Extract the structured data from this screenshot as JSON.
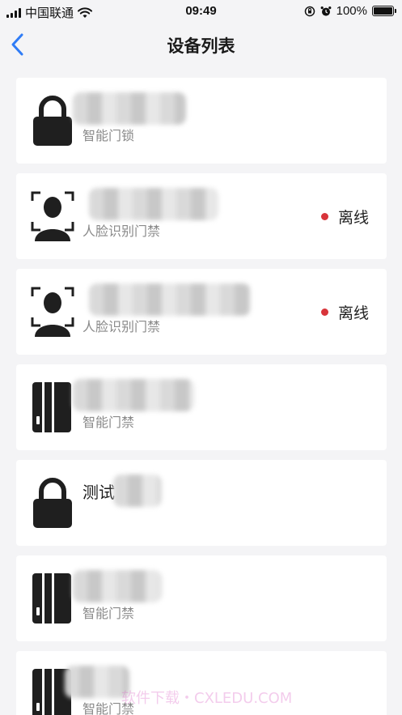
{
  "status_bar": {
    "carrier": "中国联通",
    "time": "09:49",
    "battery": "100%",
    "battery_level": 1.0
  },
  "nav": {
    "title": "设备列表",
    "back_icon": "chevron-left-icon"
  },
  "devices": [
    {
      "name": "",
      "type": "智能门锁",
      "icon": "lock-icon",
      "status": ""
    },
    {
      "name": "",
      "type": "人脸识别门禁",
      "icon": "face-recognition-icon",
      "status": "离线"
    },
    {
      "name": "",
      "type": "人脸识别门禁",
      "icon": "face-recognition-icon",
      "status": "离线"
    },
    {
      "name": "",
      "type": "智能门禁",
      "icon": "card-reader-icon",
      "status": ""
    },
    {
      "name": "测试",
      "type": "",
      "icon": "lock-icon",
      "status": ""
    },
    {
      "name": "",
      "type": "智能门禁",
      "icon": "card-reader-icon",
      "status": ""
    },
    {
      "name": "",
      "type": "智能门禁",
      "icon": "card-reader-icon",
      "status": ""
    }
  ],
  "colors": {
    "accent": "#2f7cf6",
    "offline_dot": "#d8343a",
    "background": "#f4f4f6"
  },
  "watermark": "软件下载・CXLEDU.COM"
}
